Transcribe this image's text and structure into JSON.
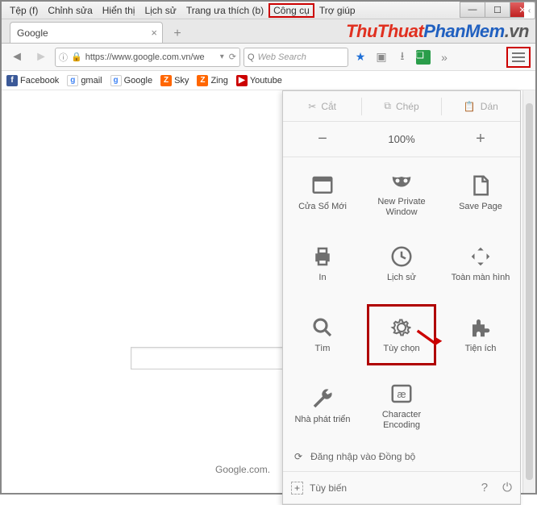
{
  "menubar": {
    "items": [
      "Tệp (f)",
      "Chỉnh sửa",
      "Hiển thị",
      "Lịch sử",
      "Trang ưa thích (b)",
      "Công cụ",
      "Trợ giúp"
    ],
    "highlighted_index": 5
  },
  "tab": {
    "title": "Google"
  },
  "url": {
    "text": "https://www.google.com.vn/we"
  },
  "search": {
    "placeholder": "Web Search"
  },
  "watermark": {
    "a": "ThuThuat",
    "b": "PhanMem",
    "c": ".vn"
  },
  "bookmarks": [
    {
      "icon": "fb",
      "label": "Facebook"
    },
    {
      "icon": "gg",
      "label": "gmail"
    },
    {
      "icon": "gg",
      "label": "Google"
    },
    {
      "icon": "zi",
      "label": "Sky"
    },
    {
      "icon": "zi",
      "label": "Zing"
    },
    {
      "icon": "yt",
      "label": "Youtube"
    }
  ],
  "panel": {
    "edit": {
      "cut": "Cắt",
      "copy": "Chép",
      "paste": "Dán"
    },
    "zoom": {
      "value": "100%"
    },
    "grid": [
      {
        "id": "new-window",
        "label": "Cửa Sổ Mới"
      },
      {
        "id": "private",
        "label": "New Private Window"
      },
      {
        "id": "save",
        "label": "Save Page"
      },
      {
        "id": "print",
        "label": "In"
      },
      {
        "id": "history",
        "label": "Lịch sử"
      },
      {
        "id": "fullscreen",
        "label": "Toàn màn hình"
      },
      {
        "id": "find",
        "label": "Tìm"
      },
      {
        "id": "options",
        "label": "Tùy chọn",
        "highlight": true
      },
      {
        "id": "addons",
        "label": "Tiện ích"
      },
      {
        "id": "developer",
        "label": "Nhà phát triển"
      },
      {
        "id": "encoding",
        "label": "Character Encoding"
      }
    ],
    "sync": "Đăng nhập vào Đồng bộ",
    "customize": "Tùy biến"
  },
  "page": {
    "footer": "Google.com."
  }
}
